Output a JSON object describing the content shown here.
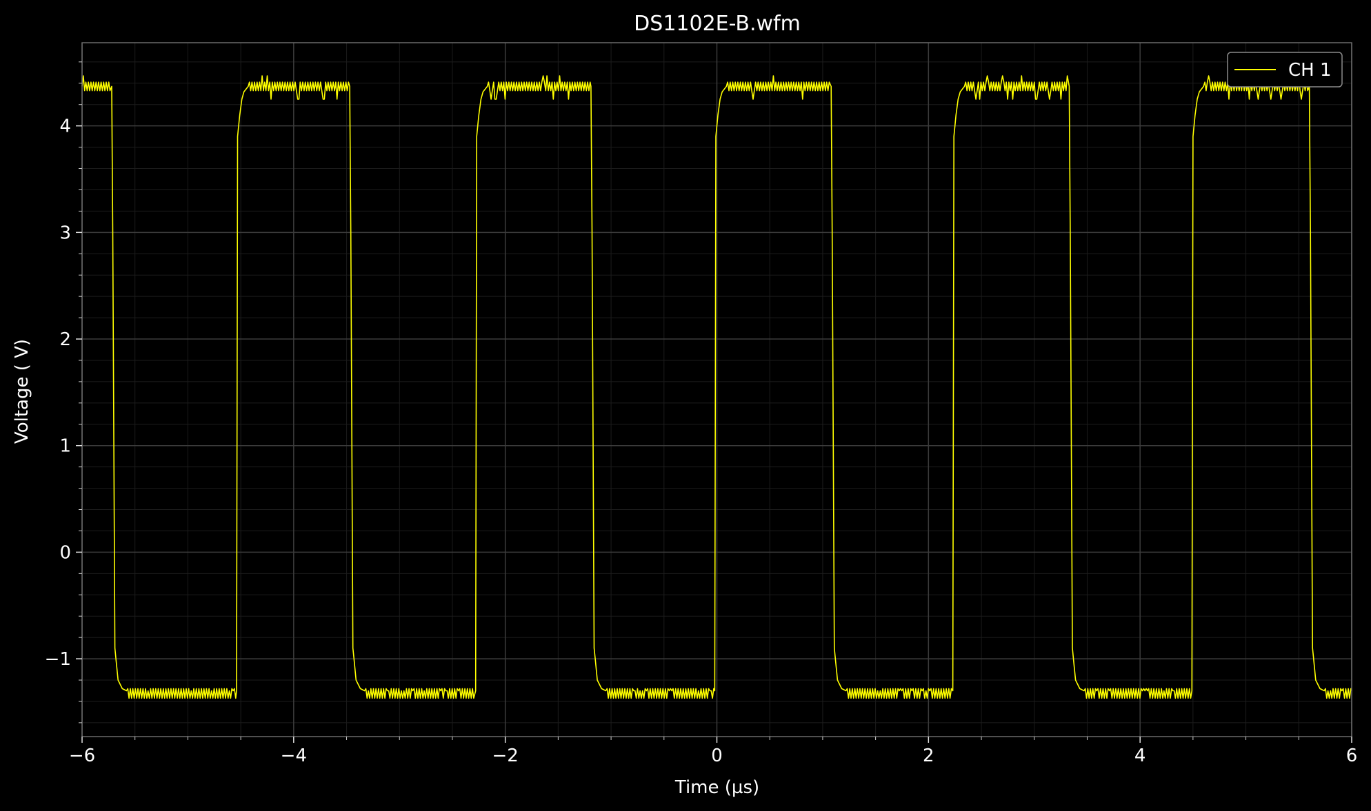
{
  "chart_data": {
    "type": "line",
    "title": "DS1102E-B.wfm",
    "xlabel": "Time (µs)",
    "ylabel": "Voltage ( V)",
    "xlim": [
      -6,
      6
    ],
    "ylim": [
      -1.73,
      4.78
    ],
    "xticks": [
      -6,
      -4,
      -2,
      0,
      2,
      4,
      6
    ],
    "xtick_labels": [
      "−6",
      "−4",
      "−2",
      "0",
      "2",
      "4",
      "6"
    ],
    "yticks": [
      -1,
      0,
      1,
      2,
      3,
      4
    ],
    "ytick_labels": [
      "−1",
      "0",
      "1",
      "2",
      "3",
      "4"
    ],
    "grid": true,
    "legend": {
      "position": "top-right",
      "entries": [
        "CH 1"
      ]
    },
    "series": [
      {
        "name": "CH 1",
        "color": "#ffff00",
        "high_level": 4.37,
        "low_level": -1.3,
        "x": [
          -6.0,
          -5.72,
          -5.71,
          -5.69,
          -5.68,
          -5.66,
          -5.62,
          -5.58,
          -4.54,
          -4.53,
          -4.51,
          -4.49,
          -4.47,
          -4.43,
          -3.47,
          -3.46,
          -3.44,
          -3.43,
          -3.41,
          -3.37,
          -3.33,
          -2.28,
          -2.27,
          -2.25,
          -2.23,
          -2.21,
          -2.17,
          -1.19,
          -1.18,
          -1.16,
          -1.15,
          -1.13,
          -1.09,
          -1.05,
          -0.02,
          -0.01,
          0.01,
          0.03,
          0.05,
          0.09,
          1.08,
          1.09,
          1.11,
          1.12,
          1.14,
          1.18,
          1.22,
          2.23,
          2.24,
          2.26,
          2.28,
          2.3,
          2.34,
          3.33,
          3.34,
          3.36,
          3.37,
          3.39,
          3.43,
          3.47,
          4.49,
          4.5,
          4.52,
          4.54,
          4.56,
          4.6,
          5.6,
          5.61,
          5.63,
          5.64,
          5.66,
          5.7,
          5.74,
          6.0
        ],
        "y": [
          4.37,
          4.37,
          3.0,
          -0.9,
          -1.0,
          -1.2,
          -1.28,
          -1.3,
          -1.3,
          3.9,
          4.1,
          4.25,
          4.32,
          4.37,
          4.37,
          3.0,
          -0.9,
          -1.0,
          -1.2,
          -1.28,
          -1.3,
          -1.3,
          3.9,
          4.1,
          4.25,
          4.32,
          4.37,
          4.37,
          3.0,
          -0.9,
          -1.0,
          -1.2,
          -1.28,
          -1.3,
          -1.3,
          3.9,
          4.1,
          4.25,
          4.32,
          4.37,
          4.37,
          3.0,
          -0.9,
          -1.0,
          -1.2,
          -1.28,
          -1.3,
          -1.3,
          3.9,
          4.1,
          4.25,
          4.32,
          4.37,
          4.37,
          3.0,
          -0.9,
          -1.0,
          -1.2,
          -1.28,
          -1.3,
          -1.3,
          3.9,
          4.1,
          4.25,
          4.32,
          4.37,
          4.37,
          3.0,
          -0.9,
          -1.0,
          -1.2,
          -1.28,
          -1.3,
          -1.3
        ]
      }
    ]
  }
}
